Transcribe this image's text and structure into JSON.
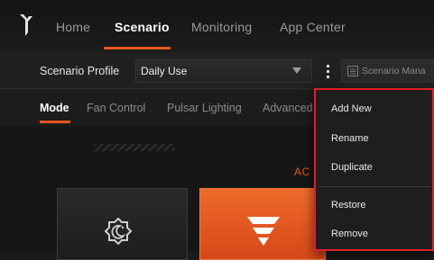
{
  "nav": {
    "items": [
      {
        "label": "Home"
      },
      {
        "label": "Scenario"
      },
      {
        "label": "Monitoring"
      },
      {
        "label": "App Center"
      }
    ],
    "active": "Scenario"
  },
  "profile": {
    "label": "Scenario Profile",
    "selected": "Daily Use",
    "manager_label": "Scenario Mana"
  },
  "tabs": {
    "items": [
      {
        "label": "Mode"
      },
      {
        "label": "Fan Control"
      },
      {
        "label": "Pulsar Lighting"
      },
      {
        "label": "Advanced"
      }
    ],
    "active": "Mode"
  },
  "main": {
    "mode_heading": "AC"
  },
  "menu": {
    "items": [
      {
        "label": "Add New"
      },
      {
        "label": "Rename"
      },
      {
        "label": "Duplicate"
      },
      {
        "label": "Restore"
      },
      {
        "label": "Remove"
      }
    ]
  },
  "colors": {
    "accent": "#e8541c",
    "highlight_border": "#e21f26"
  },
  "icons": {
    "logo": "predator-logo-icon",
    "dropdown": "chevron-down-icon",
    "kebab": "more-vertical-icon",
    "manager": "list-icon",
    "mode_silent": "moon-icon",
    "mode_performance": "predator-mark-icon"
  }
}
